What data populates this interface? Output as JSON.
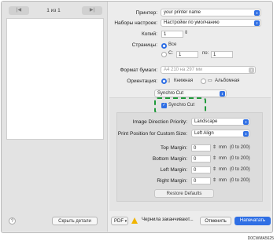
{
  "preview": {
    "page_counter": "1 из 1",
    "prev_icon": "skip-back-icon",
    "next_icon": "skip-forward-icon"
  },
  "printer": {
    "label": "Принтер:",
    "value": "your printer name"
  },
  "presets": {
    "label": "Наборы настроек:",
    "value": "Настройки по умолчанию"
  },
  "copies": {
    "label": "Копий:",
    "value": "1"
  },
  "pages": {
    "label": "Страницы:",
    "all": "Все",
    "from_label": "С:",
    "from_value": "1",
    "to_label": "по:",
    "to_value": "1"
  },
  "paper": {
    "label": "Формат бумаги:",
    "value": "А4 210 на 297 мм"
  },
  "orientation": {
    "label": "Ориентация:",
    "portrait": "Книжная",
    "landscape": "Альбомная"
  },
  "section": {
    "value": "Synchro Cut"
  },
  "synchro_cut": {
    "label": "Synchro Cut",
    "checked": true
  },
  "settings": {
    "image_direction_label": "Image Direction Priority:",
    "image_direction_value": "Landscape",
    "print_position_label": "Print Position for Custom Size:",
    "print_position_value": "Left Align",
    "margins": [
      {
        "label": "Top Margin:",
        "value": "0",
        "unit": "mm",
        "range": "(0 to 200)"
      },
      {
        "label": "Bottom Margin:",
        "value": "0",
        "unit": "mm",
        "range": "(0 to 200)"
      },
      {
        "label": "Left Margin:",
        "value": "0",
        "unit": "mm",
        "range": "(0 to 200)"
      },
      {
        "label": "Right Margin:",
        "value": "0",
        "unit": "mm",
        "range": "(0 to 200)"
      }
    ],
    "restore_label": "Restore Defaults"
  },
  "footer": {
    "help": "?",
    "hide_details": "Скрыть детали",
    "pdf": "PDF",
    "warning": "Чернила заканчивают...",
    "cancel": "Отменить",
    "print": "Напечатать"
  },
  "image_code": "D0CWMA5625",
  "colors": {
    "accent": "#2f6fe4",
    "highlight": "#1f9a3a",
    "warning": "#f0b400"
  }
}
